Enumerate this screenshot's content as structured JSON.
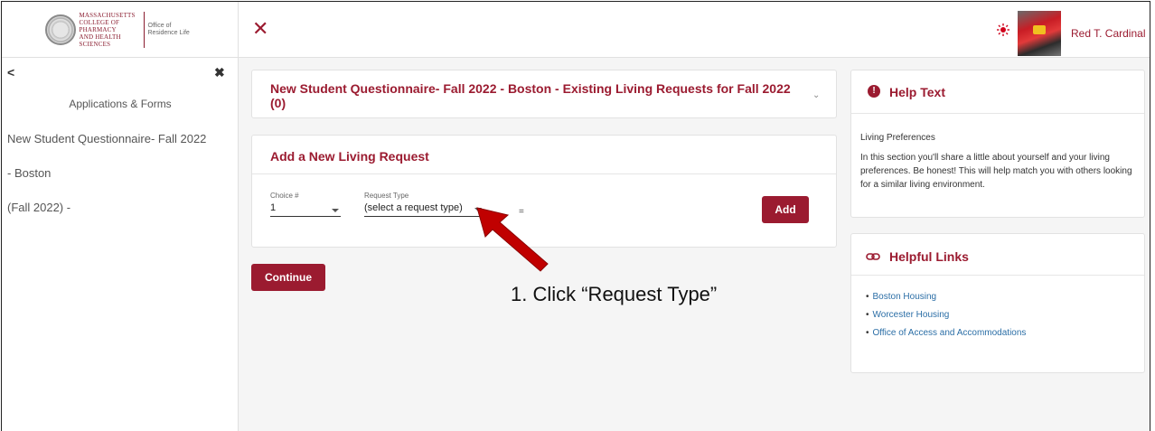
{
  "header": {
    "logo_line1": "Massachusetts",
    "logo_line2": "College of Pharmacy",
    "logo_line3": "and Health Sciences",
    "logo_office": "Office of Residence Life",
    "close_icon": "close-icon",
    "theme_icon": "sun-icon",
    "user_name": "Red T. Cardinal"
  },
  "sidebar": {
    "back_icon": "chevron-left-icon",
    "close_icon": "close-icon",
    "title": "Applications & Forms",
    "items": [
      {
        "label": "New Student Questionnaire- Fall 2022"
      },
      {
        "label": "- Boston"
      },
      {
        "label": "(Fall 2022) -"
      }
    ]
  },
  "main": {
    "existing_requests": {
      "title": "New Student Questionnaire- Fall 2022 - Boston - Existing Living Requests for Fall 2022 (0)"
    },
    "add_request": {
      "title": "Add a New Living Request",
      "choice_label": "Choice #",
      "choice_value": "1",
      "request_type_label": "Request Type",
      "request_type_value": "(select a request type)",
      "equals": "=",
      "add_button": "Add"
    },
    "continue_button": "Continue"
  },
  "help": {
    "title": "Help Text",
    "heading": "Living Preferences",
    "body": "In this section you'll share a little about yourself and your living preferences. Be honest! This will help match you with others looking for a similar living environment."
  },
  "links": {
    "title": "Helpful Links",
    "items": [
      "Boston Housing",
      "Worcester Housing",
      "Office of Access and Accommodations"
    ]
  },
  "annotation": {
    "text": "1. Click “Request Type”",
    "arrow_color": "#c00000"
  },
  "colors": {
    "brand": "#9b1b30",
    "link": "#2b6ea6"
  }
}
